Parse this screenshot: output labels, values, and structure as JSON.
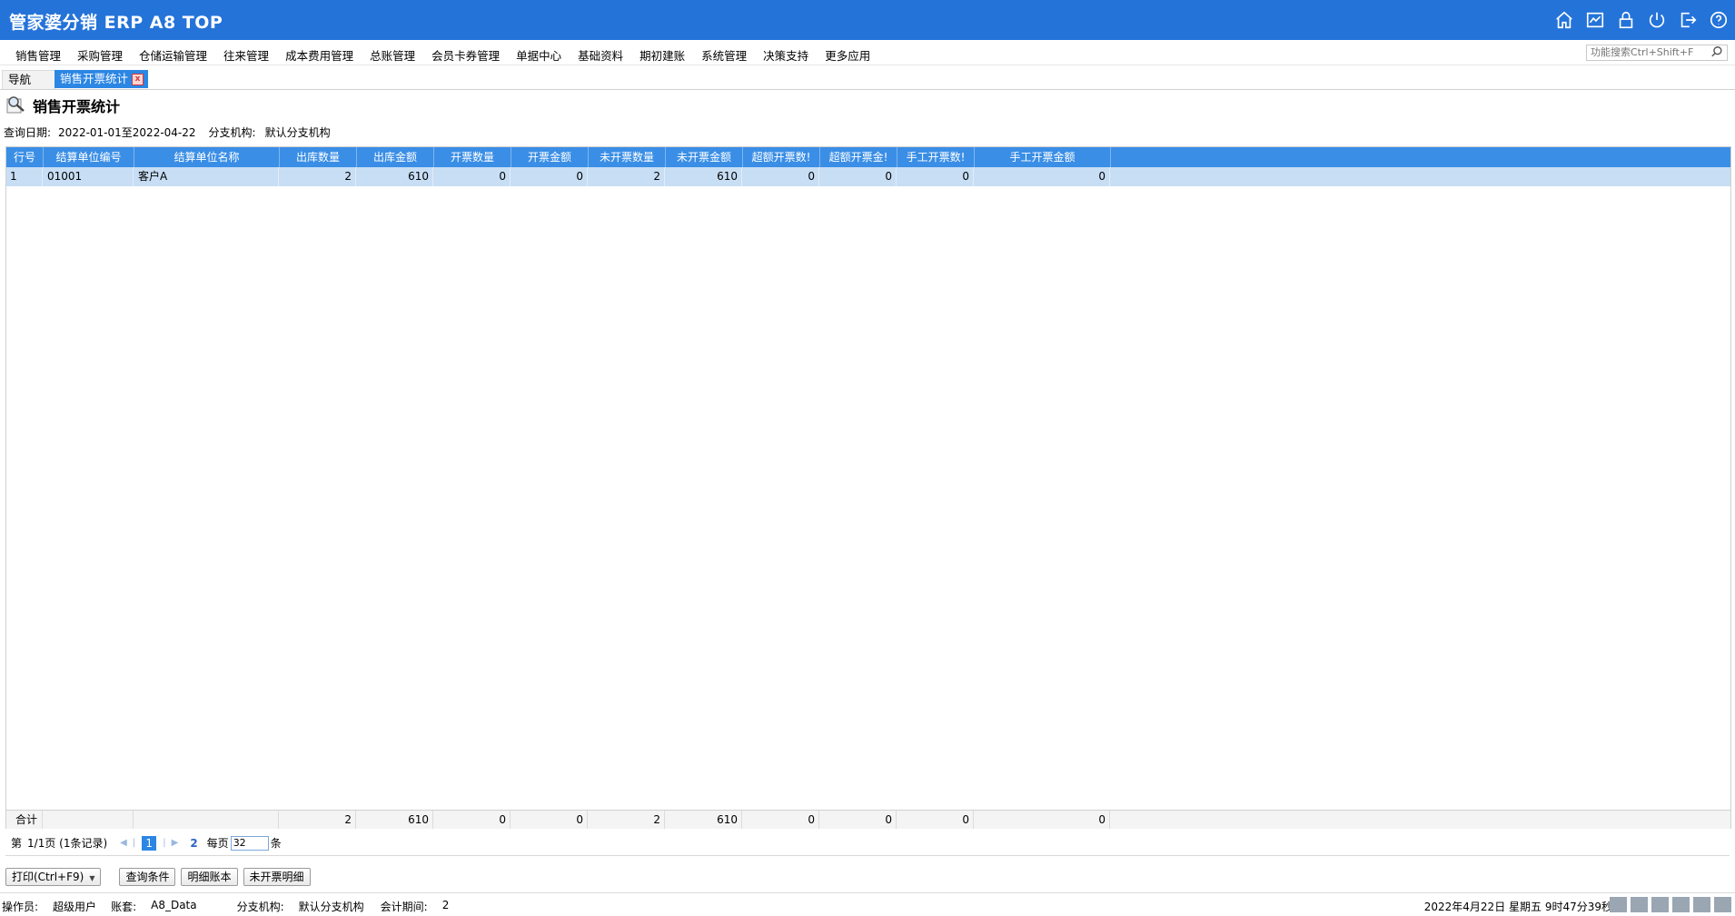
{
  "app": {
    "title": "管家婆分销 ERP A8 TOP"
  },
  "menu": {
    "items": [
      "销售管理",
      "采购管理",
      "仓储运输管理",
      "往来管理",
      "成本费用管理",
      "总账管理",
      "会员卡券管理",
      "单据中心",
      "基础资料",
      "期初建账",
      "系统管理",
      "决策支持",
      "更多应用"
    ],
    "search_placeholder": "功能搜索Ctrl+Shift+F"
  },
  "tabs": {
    "nav": "导航",
    "active": "销售开票统计",
    "close": "x"
  },
  "page": {
    "title": "销售开票统计"
  },
  "query": {
    "date_label": "查询日期:",
    "date_value": "2022-01-01至2022-04-22",
    "branch_label": "分支机构:",
    "branch_value": "默认分支机构"
  },
  "table": {
    "headers": [
      "行号",
      "结算单位编号",
      "结算单位名称",
      "出库数量",
      "出库金额",
      "开票数量",
      "开票金额",
      "未开票数量",
      "未开票金额",
      "超额开票数!",
      "超额开票金!",
      "手工开票数!",
      "手工开票金额"
    ],
    "rows": [
      [
        "1",
        "01001",
        "客户A",
        "2",
        "610",
        "0",
        "0",
        "2",
        "610",
        "0",
        "0",
        "0",
        "0"
      ]
    ],
    "footer": [
      "合计",
      "",
      "",
      "2",
      "610",
      "0",
      "0",
      "2",
      "610",
      "0",
      "0",
      "0",
      "0"
    ]
  },
  "pager": {
    "prefix": "第",
    "page_info": "1/1页 (1条记录)",
    "current": "1",
    "next_link": "2",
    "per_page_label": "每页",
    "per_page_value": "32",
    "unit": "条"
  },
  "buttons": {
    "print": "打印(Ctrl+F9)",
    "query": "查询条件",
    "detail": "明细账本",
    "uninvoiced": "未开票明细"
  },
  "status": {
    "operator_label": "操作员:",
    "operator": "超级用户",
    "account_label": "账套:",
    "account": "A8_Data",
    "branch_label": "分支机构:",
    "branch": "默认分支机构",
    "period_label": "会计期间:",
    "period": "2",
    "datetime": "2022年4月22日 星期五 9时47分39秒"
  }
}
